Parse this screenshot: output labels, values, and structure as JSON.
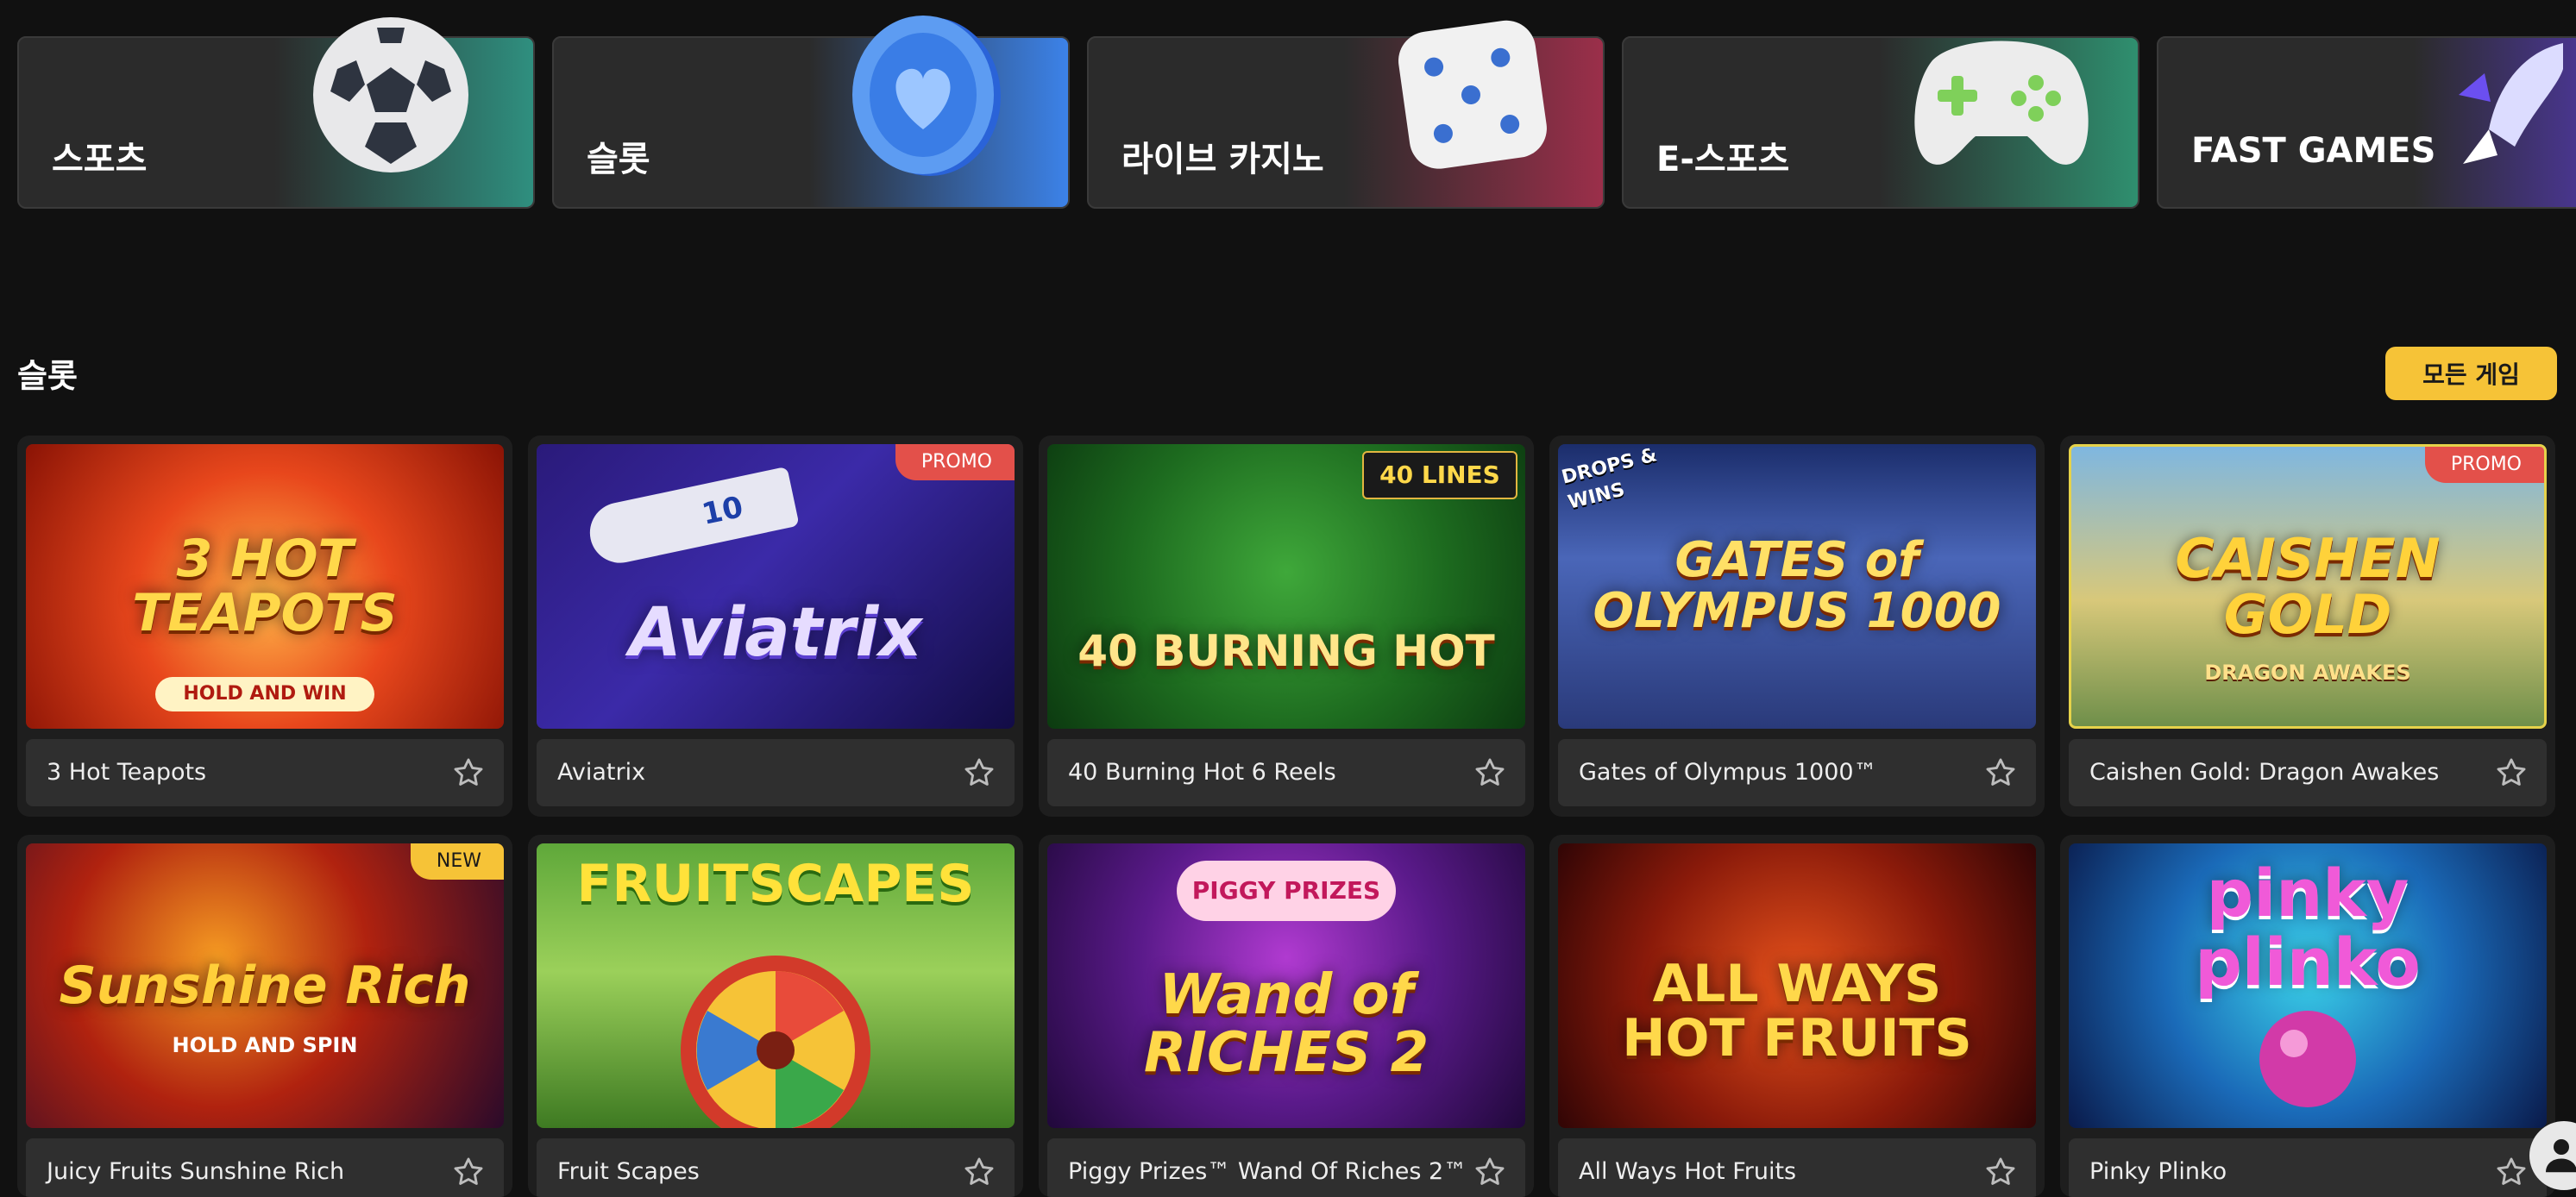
{
  "categories": [
    {
      "label": "스포츠",
      "icon": "soccer-ball-icon",
      "accent": "#2f8f7f"
    },
    {
      "label": "슬롯",
      "icon": "coin-icon",
      "accent": "#3c82e8"
    },
    {
      "label": "라이브 카지노",
      "icon": "dice-icon",
      "accent": "#9b2f4a"
    },
    {
      "label": "E-스포츠",
      "icon": "gamepad-icon",
      "accent": "#2f8f6f"
    },
    {
      "label": "FAST GAMES",
      "icon": "rocket-icon",
      "accent": "#5a3cc8"
    }
  ],
  "section": {
    "title": "슬롯",
    "all_games_label": "모든 게임"
  },
  "games": [
    {
      "name": "3 Hot Teapots",
      "art": "3 HOT TEAPOTS",
      "tag": "HOLD AND WIN",
      "badge": ""
    },
    {
      "name": "Aviatrix",
      "art": "Aviatrix",
      "tag": "10",
      "badge": "PROMO"
    },
    {
      "name": "40 Burning Hot 6 Reels",
      "art": "40 BURNING HOT",
      "tag": "40 LINES",
      "badge": ""
    },
    {
      "name": "Gates of Olympus 1000™",
      "art": "GATES of OLYMPUS 1000",
      "tag": "DROPS & WINS",
      "badge": ""
    },
    {
      "name": "Caishen Gold: Dragon Awakes",
      "art": "CAISHEN GOLD",
      "tag": "DRAGON AWAKES",
      "badge": "PROMO"
    },
    {
      "name": "Juicy Fruits Sunshine Rich",
      "art": "Sunshine Rich",
      "tag": "HOLD AND SPIN",
      "badge": "NEW"
    },
    {
      "name": "Fruit Scapes",
      "art": "FRUITSCAPES",
      "tag": "",
      "badge": ""
    },
    {
      "name": "Piggy Prizes™ Wand Of Riches 2™",
      "art": "Wand of RICHES 2",
      "tag": "PIGGY PRIZES",
      "badge": ""
    },
    {
      "name": "All Ways Hot Fruits",
      "art": "ALL WAYS HOT FRUITS",
      "tag": "",
      "badge": ""
    },
    {
      "name": "Pinky Plinko",
      "art": "pinky plinko",
      "tag": "",
      "badge": ""
    }
  ]
}
